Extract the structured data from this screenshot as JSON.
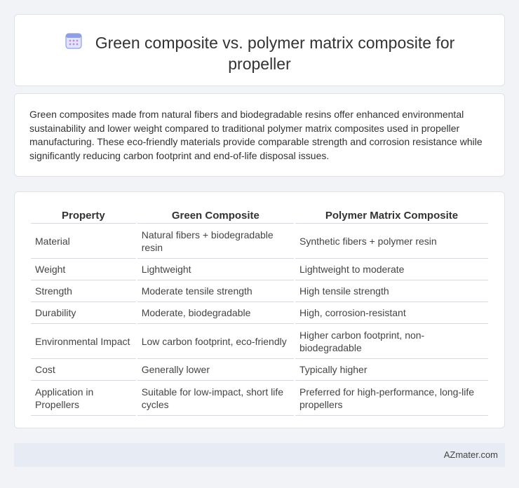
{
  "header": {
    "icon": "calendar-icon",
    "title": "Green composite vs. polymer matrix composite for propeller"
  },
  "intro": {
    "text": "Green composites made from natural fibers and biodegradable resins offer enhanced environmental sustainability and lower weight compared to traditional polymer matrix composites used in propeller manufacturing. These eco-friendly materials provide comparable strength and corrosion resistance while significantly reducing carbon footprint and end-of-life disposal issues."
  },
  "table": {
    "headers": [
      "Property",
      "Green Composite",
      "Polymer Matrix Composite"
    ],
    "rows": [
      [
        "Material",
        "Natural fibers + biodegradable resin",
        "Synthetic fibers + polymer resin"
      ],
      [
        "Weight",
        "Lightweight",
        "Lightweight to moderate"
      ],
      [
        "Strength",
        "Moderate tensile strength",
        "High tensile strength"
      ],
      [
        "Durability",
        "Moderate, biodegradable",
        "High, corrosion-resistant"
      ],
      [
        "Environmental Impact",
        "Low carbon footprint, eco-friendly",
        "Higher carbon footprint, non-biodegradable"
      ],
      [
        "Cost",
        "Generally lower",
        "Typically higher"
      ],
      [
        "Application in Propellers",
        "Suitable for low-impact, short life cycles",
        "Preferred for high-performance, long-life propellers"
      ]
    ]
  },
  "footer": {
    "brand": "AZmater.com"
  },
  "colors": {
    "background": "#f1f3f6",
    "card": "#ffffff",
    "footer": "#e7ecf4",
    "icon_accent": "#7b8fe0"
  }
}
